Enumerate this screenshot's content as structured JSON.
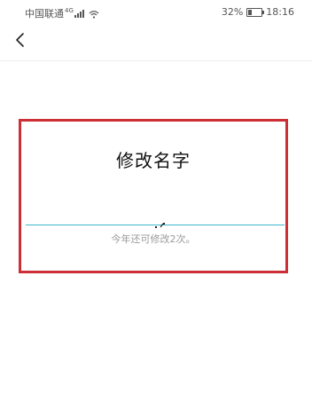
{
  "status_bar": {
    "carrier": "中国联通",
    "network": "4G",
    "battery_text": "32%",
    "battery_level": 0.32,
    "time": "18:16"
  },
  "nav": {
    "back_icon": "chevron-left-icon"
  },
  "dialog": {
    "title": "修改名字",
    "name_value": "",
    "hint": "今年还可修改2次。",
    "accent_color": "#3fb8cf",
    "highlight_border_color": "#cc2f35"
  }
}
